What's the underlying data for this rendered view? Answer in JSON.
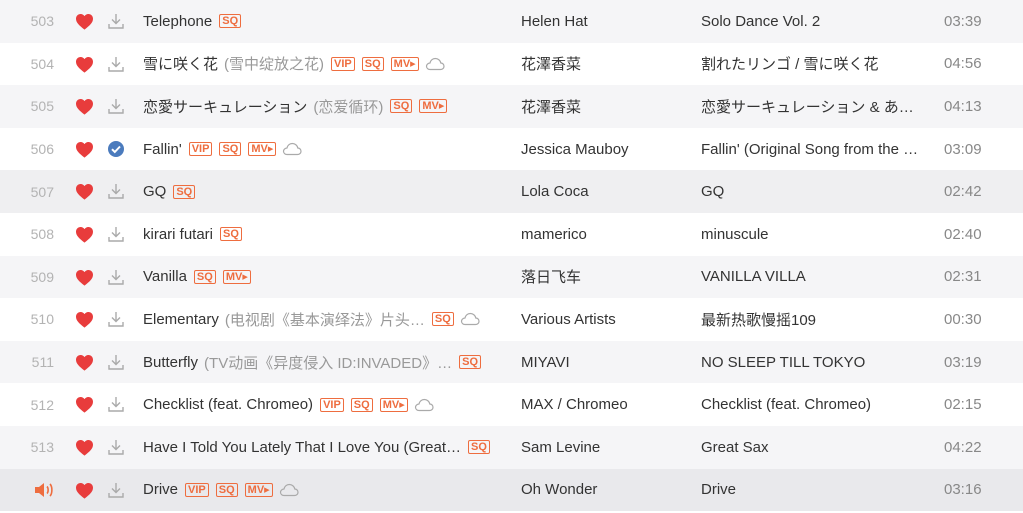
{
  "colors": {
    "heart": "#e83c3c",
    "badge": "#ee6d3f",
    "check": "#4b7bbd",
    "speaker": "#ee6d3f"
  },
  "badges": {
    "vip": "VIP",
    "sq": "SQ",
    "mv": "MV▸"
  },
  "rows": [
    {
      "num": "503",
      "title": "Telephone",
      "alias": "",
      "badges": [
        "sq"
      ],
      "cloud": false,
      "downloaded": false,
      "artist": "Helen Hat",
      "album": "Solo Dance Vol. 2",
      "duration": "03:39"
    },
    {
      "num": "504",
      "title": "雪に咲く花",
      "alias": "(雪中绽放之花)",
      "badges": [
        "vip",
        "sq",
        "mv"
      ],
      "cloud": true,
      "downloaded": false,
      "artist": "花澤香菜",
      "album": "割れたリンゴ / 雪に咲く花",
      "duration": "04:56"
    },
    {
      "num": "505",
      "title": "恋愛サーキュレーション",
      "alias": "(恋爱循环)",
      "badges": [
        "sq",
        "mv"
      ],
      "cloud": false,
      "downloaded": false,
      "artist": "花澤香菜",
      "album": "恋愛サーキュレーション & あ…",
      "duration": "04:13"
    },
    {
      "num": "506",
      "title": "Fallin'",
      "alias": "",
      "badges": [
        "vip",
        "sq",
        "mv"
      ],
      "cloud": true,
      "downloaded": true,
      "artist": "Jessica Mauboy",
      "album": "Fallin' (Original Song from the …",
      "duration": "03:09"
    },
    {
      "num": "507",
      "title": "GQ",
      "alias": "",
      "badges": [
        "sq"
      ],
      "cloud": false,
      "downloaded": false,
      "artist": "Lola Coca",
      "album": "GQ",
      "duration": "02:42"
    },
    {
      "num": "508",
      "title": "kirari futari",
      "alias": "",
      "badges": [
        "sq"
      ],
      "cloud": false,
      "downloaded": false,
      "artist": "mamerico",
      "album": "minuscule",
      "duration": "02:40"
    },
    {
      "num": "509",
      "title": "Vanilla",
      "alias": "",
      "badges": [
        "sq",
        "mv"
      ],
      "cloud": false,
      "downloaded": false,
      "artist": "落日飞车",
      "album": "VANILLA VILLA",
      "duration": "02:31"
    },
    {
      "num": "510",
      "title": "Elementary",
      "alias": "(电视剧《基本演绎法》片头…",
      "badges": [
        "sq"
      ],
      "cloud": true,
      "downloaded": false,
      "artist": "Various Artists",
      "album": "最新热歌慢摇109",
      "duration": "00:30"
    },
    {
      "num": "511",
      "title": "Butterfly",
      "alias": "(TV动画《异度侵入 ID:INVADED》…",
      "badges": [
        "sq"
      ],
      "cloud": false,
      "downloaded": false,
      "artist": "MIYAVI",
      "album": "NO SLEEP TILL TOKYO",
      "duration": "03:19"
    },
    {
      "num": "512",
      "title": "Checklist (feat. Chromeo)",
      "alias": "",
      "badges": [
        "vip",
        "sq",
        "mv"
      ],
      "cloud": true,
      "downloaded": false,
      "artist": "MAX / Chromeo",
      "album": "Checklist (feat. Chromeo)",
      "duration": "02:15"
    },
    {
      "num": "513",
      "title": "Have I Told You Lately That I Love You (Great…",
      "alias": "",
      "badges": [
        "sq"
      ],
      "cloud": false,
      "downloaded": false,
      "artist": "Sam Levine",
      "album": "Great Sax",
      "duration": "04:22"
    },
    {
      "num": "",
      "title": "Drive",
      "alias": "",
      "badges": [
        "vip",
        "sq",
        "mv"
      ],
      "cloud": true,
      "downloaded": false,
      "playing": true,
      "artist": "Oh Wonder",
      "album": "Drive",
      "duration": "03:16"
    }
  ]
}
